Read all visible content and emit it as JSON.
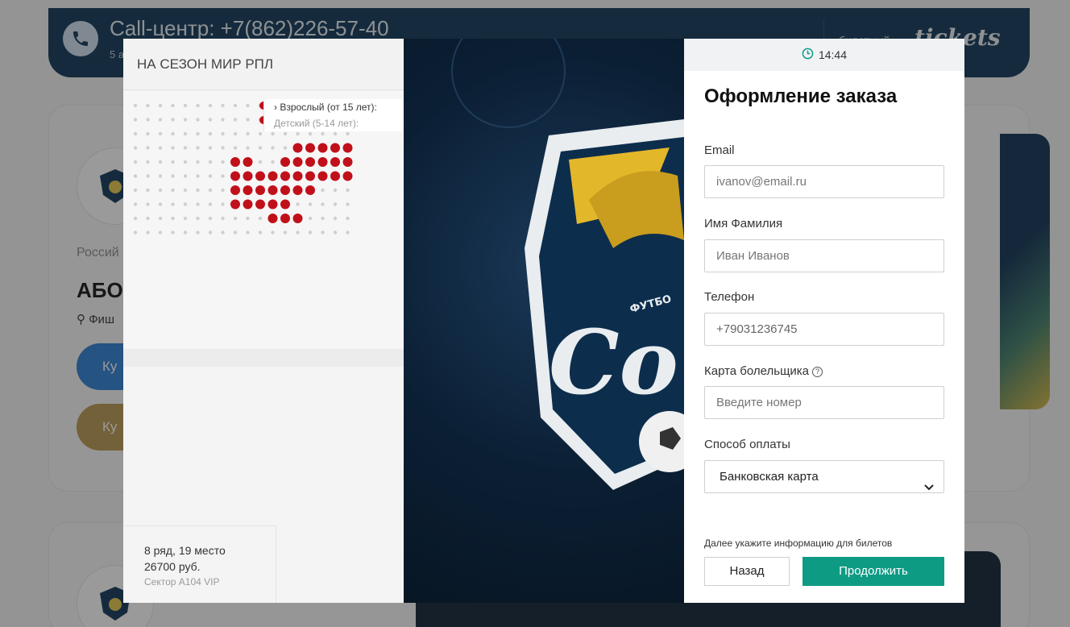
{
  "background": {
    "call_title": "Call-центр: +7(862)226-57-40",
    "call_sub": "5 а",
    "brand_small": "билетный",
    "brand_logo": "tickets",
    "card1_country": "Россий",
    "card1_title": "АБО",
    "card1_location": "Фиш",
    "card1_btn1": "Ку",
    "card1_btn2": "Ку"
  },
  "left_panel": {
    "title": "НА СЕЗОН МИР РПЛ",
    "tariffs": [
      {
        "label": "› Взрослый (от 15 лет):",
        "active": true
      },
      {
        "label": "Детский (5-14 лет):",
        "active": false
      }
    ],
    "ticket": {
      "row_seat": "8 ряд, 19 место",
      "price": "26700 руб.",
      "sector": "Сектор A104 VIP"
    }
  },
  "form": {
    "timer": "14:44",
    "title": "Оформление заказа",
    "email_label": "Email",
    "email_placeholder": "ivanov@email.ru",
    "name_label": "Имя Фамилия",
    "name_placeholder": "Иван Иванов",
    "phone_label": "Телефон",
    "phone_value": "+79031236745",
    "fan_card_label": "Карта болельщика",
    "fan_card_placeholder": "Введите номер",
    "payment_label": "Способ оплаты",
    "payment_selected": "Банковская карта",
    "note": "Далее укажите информацию для билетов",
    "back_button": "Назад",
    "continue_button": "Продолжить"
  },
  "colors": {
    "accent": "#0e9b84",
    "callbar": "#0d3556",
    "seat_taken": "#c0101a",
    "btn_blue": "#2b7fd4",
    "btn_gold": "#b9974f"
  }
}
